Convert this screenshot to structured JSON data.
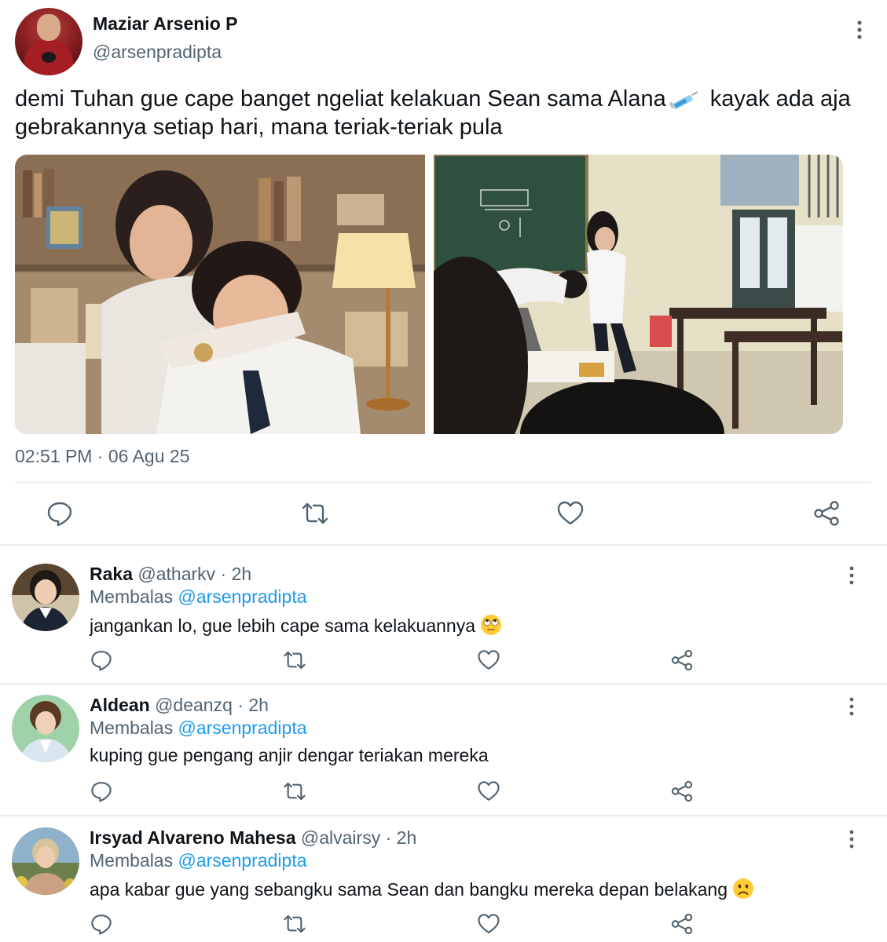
{
  "tweet": {
    "author_name": "Maziar Arsenio P",
    "author_handle": "@arsenpradipta",
    "text_before_emoji": "demi Tuhan gue cape banget ngeliat kelakuan Sean sama Alana",
    "text_after_emoji": " kayak ada aja gebrakannya setiap hari, mana teriak-teriak pula",
    "emoji": "syringe-emoji",
    "timestamp": "02:51 PM · 06 Agu 25"
  },
  "replies": [
    {
      "name": "Raka",
      "handle": "@atharkv",
      "age": "2h",
      "replying_label": "Membalas",
      "replying_to": "@arsenpradipta",
      "text": "jangankan lo, gue lebih cape sama kelakuannya",
      "emoji": "eye-roll-emoji"
    },
    {
      "name": "Aldean",
      "handle": "@deanzq",
      "age": "2h",
      "replying_label": "Membalas",
      "replying_to": "@arsenpradipta",
      "text": "kuping gue pengang anjir dengar teriakan mereka",
      "emoji": ""
    },
    {
      "name": "Irsyad Alvareno Mahesa",
      "handle": "@alvairsy",
      "age": "2h",
      "replying_label": "Membalas",
      "replying_to": "@arsenpradipta",
      "text": "apa kabar gue yang sebangku sama Sean dan bangku mereka depan belakang",
      "emoji": "frowning-face-emoji"
    }
  ],
  "colors": {
    "text": "#0f1419",
    "muted": "#536471",
    "link": "#1d9bf0",
    "divider": "#e1e8ed"
  },
  "icons": [
    "reply-icon",
    "retweet-icon",
    "like-icon",
    "share-icon",
    "more-icon"
  ]
}
